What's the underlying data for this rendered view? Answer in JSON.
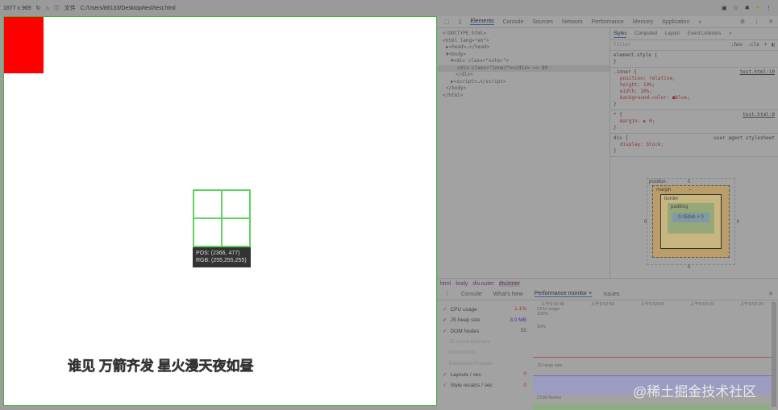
{
  "topbar": {
    "size": "1677 x 969",
    "scheme": "文件",
    "url": "C:/Users/86133/Desktop/test/test.html"
  },
  "overlay": {
    "pos": "POS:  (2366, 477)",
    "rgb": "RGB:  (255,255,255)"
  },
  "devtools": {
    "tabs": [
      "Elements",
      "Console",
      "Sources",
      "Network",
      "Performance",
      "Memory",
      "Application",
      "»"
    ],
    "dom": [
      "<!DOCTYPE html>",
      "<html lang=\"en\">",
      "▶<head>…</head>",
      "▼<body>",
      "▼<div class=\"outer\">",
      "<div class=\"inner\"></div> == $0",
      "</div>",
      "▶<script>…</script>",
      "</body>",
      "</html>"
    ],
    "style_tabs": [
      "Styles",
      "Computed",
      "Layout",
      "Event Listeners",
      "»"
    ],
    "filter_placeholder": "Filter",
    "filter_tools": [
      ":hov",
      ".cls",
      "+"
    ],
    "rules": [
      {
        "selector": "element.style {",
        "source": "",
        "props": []
      },
      {
        "selector": ".inner {",
        "source": "test.html:10",
        "props": [
          "position: relative;",
          "height: 10%;",
          "width: 10%;",
          "background-color: ■blue;"
        ]
      },
      {
        "selector": "* {",
        "source": "test.html:8",
        "props": [
          "margin: ▶ 0;"
        ]
      },
      {
        "selector": "div {",
        "source": "user agent stylesheet",
        "props": [
          "display: block;"
        ]
      }
    ],
    "boxmodel": {
      "position": "position",
      "pos_val": "0",
      "margin": "margin",
      "border": "border",
      "padding": "padding",
      "content": "0.153vh × 0",
      "dash": "–"
    },
    "breadcrumb": [
      "html",
      "body",
      "div.outer",
      "div.inner"
    ],
    "drawer_tabs": [
      "Console",
      "What's New",
      "Performance monitor ×",
      "Issues"
    ],
    "metrics": [
      {
        "label": "CPU usage",
        "value": "1.1%",
        "checked": true
      },
      {
        "label": "JS heap size",
        "value": "3.0 MB",
        "checked": true
      },
      {
        "label": "DOM Nodes",
        "value": "55",
        "checked": true
      },
      {
        "label": "JS event listeners",
        "value": "",
        "checked": false
      },
      {
        "label": "Documents",
        "value": "",
        "checked": false
      },
      {
        "label": "Document Frames",
        "value": "",
        "checked": false
      },
      {
        "label": "Layouts / sec",
        "value": "0",
        "checked": true
      },
      {
        "label": "Style recalcs / sec",
        "value": "0",
        "checked": true
      }
    ],
    "times": [
      "上午9:52:40",
      "上午9:52:50",
      "上午9:53:00",
      "上午9:53:10",
      "上午9:53:20"
    ],
    "chart_labels": {
      "cpu": "CPU usage",
      "p100": "100%",
      "p50": "50%",
      "heap": "JS heap size",
      "dom": "DOM Nodes"
    }
  },
  "watermark": {
    "subtitle": "谁见 万箭齐发 星火漫天夜如昼",
    "site": "@稀土掘金技术社区"
  }
}
